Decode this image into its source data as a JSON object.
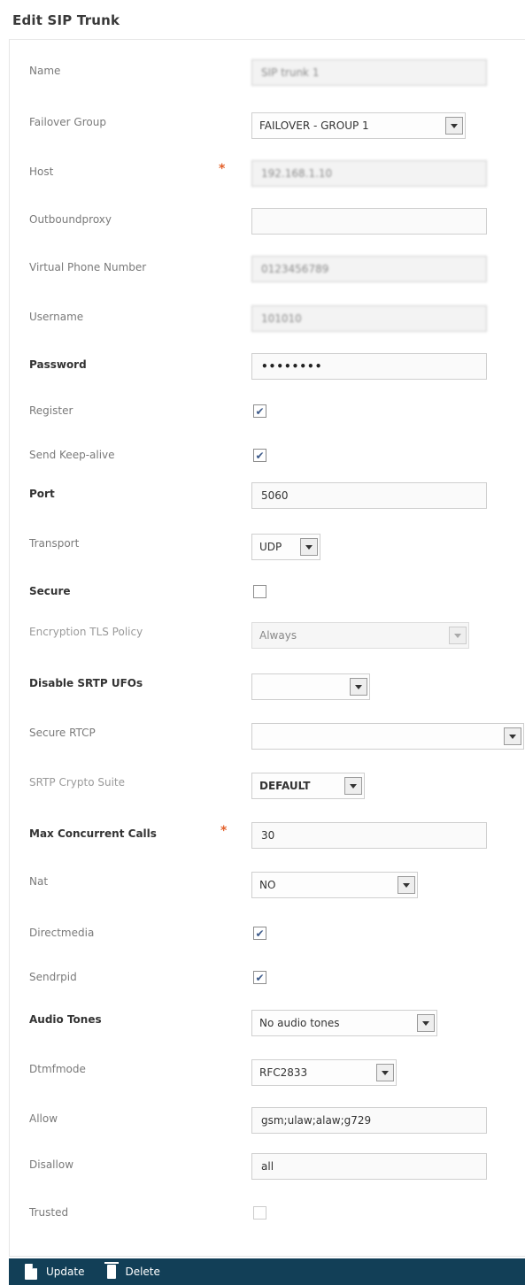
{
  "title": "Edit SIP Trunk",
  "fields": {
    "name": {
      "label": "Name",
      "value": "SIP trunk 1"
    },
    "failover_group": {
      "label": "Failover Group",
      "value": "FAILOVER - GROUP 1"
    },
    "host": {
      "label": "Host",
      "value": "192.168.1.10"
    },
    "outbound_proxy": {
      "label": "Outboundproxy",
      "value": ""
    },
    "virtual_phone": {
      "label": "Virtual Phone Number",
      "value": "0123456789"
    },
    "username": {
      "label": "Username",
      "value": "101010"
    },
    "password": {
      "label": "Password",
      "value": "••••••••"
    },
    "register": {
      "label": "Register",
      "checked": "✔"
    },
    "send_keep_alive": {
      "label": "Send Keep-alive",
      "checked": "✔"
    },
    "port": {
      "label": "Port",
      "value": "5060"
    },
    "transport": {
      "label": "Transport",
      "value": "UDP"
    },
    "secure": {
      "label": "Secure",
      "checked": ""
    },
    "encryption_policy": {
      "label": "Encryption TLS Policy",
      "value": "Always"
    },
    "disable_srtp": {
      "label": "Disable SRTP UFOs",
      "value": ""
    },
    "secure_rtcp": {
      "label": "Secure RTCP",
      "value": ""
    },
    "srtp_crypto": {
      "label": "SRTP Crypto Suite",
      "value": "DEFAULT"
    },
    "max_calls": {
      "label": "Max Concurrent Calls",
      "value": "30"
    },
    "nat": {
      "label": "Nat",
      "value": "NO"
    },
    "directmedia": {
      "label": "Directmedia",
      "checked": "✔"
    },
    "sendrpid": {
      "label": "Sendrpid",
      "checked": "✔"
    },
    "audio_tones": {
      "label": "Audio Tones",
      "value": "No audio tones"
    },
    "dtmfmode": {
      "label": "Dtmfmode",
      "value": "RFC2833"
    },
    "allow": {
      "label": "Allow",
      "value": "gsm;ulaw;alaw;g729"
    },
    "disallow": {
      "label": "Disallow",
      "value": "all"
    },
    "trusted": {
      "label": "Trusted",
      "checked": ""
    }
  },
  "footer": {
    "update_label": "Update",
    "delete_label": "Delete"
  },
  "colors": {
    "footer_bg": "#123f57",
    "required": "#e3602a",
    "check": "#3d5a8a"
  }
}
